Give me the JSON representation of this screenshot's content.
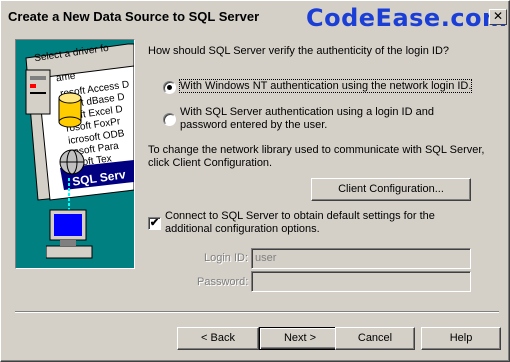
{
  "window": {
    "title": "Create a New Data Source to SQL Server",
    "watermark": "CodeEase.com",
    "close_glyph": "✕"
  },
  "art": {
    "caption": "Select a driver fo",
    "list_header": "ame",
    "list_items": [
      "rosoft Access D",
      "osoft dBase D",
      "osoft Excel D",
      "rosoft FoxPr",
      "icrosoft ODB",
      "rosoft Para",
      "osoft Tex"
    ],
    "banner": "SQL Serv",
    "colors": {
      "background": "#008080",
      "banner": "#000080",
      "screen": "#0000ff",
      "database": "#ffcc00"
    },
    "icons": [
      "server-icon",
      "database-icon",
      "globe-icon",
      "computer-icon"
    ]
  },
  "question": "How should SQL Server verify the authenticity of the login ID?",
  "auth": {
    "nt_label": "With Windows NT authentication using the network login ID.",
    "sql_label": "With SQL Server authentication using a login ID and password entered by the user.",
    "selected": "nt"
  },
  "network": {
    "text": "To change the network library used to communicate with SQL Server, click Client Configuration.",
    "button": "Client Configuration..."
  },
  "connect": {
    "label": "Connect to SQL Server to obtain default settings for the additional configuration options.",
    "checked": true
  },
  "login": {
    "login_label": "Login ID:",
    "login_value": "user",
    "password_label": "Password:",
    "password_value": ""
  },
  "buttons": {
    "back": "< Back",
    "next": "Next >",
    "cancel": "Cancel",
    "help": "Help"
  }
}
